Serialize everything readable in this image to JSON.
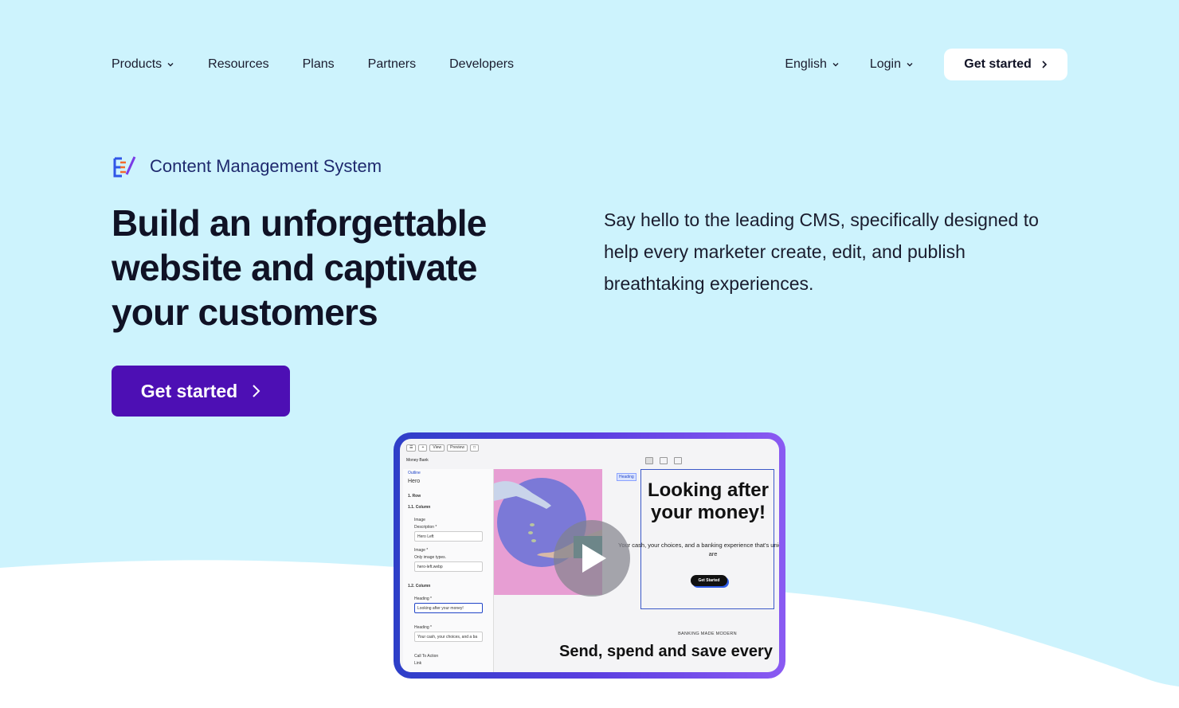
{
  "nav": {
    "items": [
      {
        "label": "Products",
        "dropdown": true
      },
      {
        "label": "Resources",
        "dropdown": false
      },
      {
        "label": "Plans",
        "dropdown": false
      },
      {
        "label": "Partners",
        "dropdown": false
      },
      {
        "label": "Developers",
        "dropdown": false
      }
    ],
    "language": "English",
    "login": "Login",
    "cta": "Get started"
  },
  "hero": {
    "eyebrow": "Content Management System",
    "headline": {
      "part1": "Build an ",
      "bold1": "unforgettable",
      "bold2": "website",
      "part2": " and ",
      "bold3": "captivate",
      "bold4": "your customers"
    },
    "description": "Say hello to the leading CMS, specifically designed to help every marketer create, edit, and publish breathtaking experiences.",
    "cta": "Get started"
  },
  "video": {
    "toolbar": {
      "view": "View",
      "preview": "Preview"
    },
    "site_name": "Money Bank",
    "panel": {
      "back": "Outline",
      "section": "Hero",
      "row": "1. Row",
      "column1": "1.1. Column",
      "image_label": "Image",
      "description_label": "Description *",
      "description_value": "Hero Left",
      "image2_label": "Image *",
      "image2_hint": "Only image types.",
      "image2_value": "hero-left.webp",
      "column2": "1.2. Column",
      "heading_label": "Heading *",
      "heading_value": "Looking after your money!",
      "heading2_label": "Heading *",
      "heading2_value": "Your cash, your choices, and a ba",
      "cta_label": "Call To Action",
      "link_label": "Link"
    },
    "preview": {
      "tag": "Heading",
      "heading": "Looking after your money!",
      "sub": "Your cash, your choices, and a banking experience that's unique as you are",
      "button": "Get Started",
      "eyebrow": "BANKING MADE MODERN",
      "send": "Send, spend and save every"
    }
  },
  "colors": {
    "background": "#cdf3fd",
    "cta": "#4d0fb4",
    "video_frame": "#5a3ee0"
  }
}
